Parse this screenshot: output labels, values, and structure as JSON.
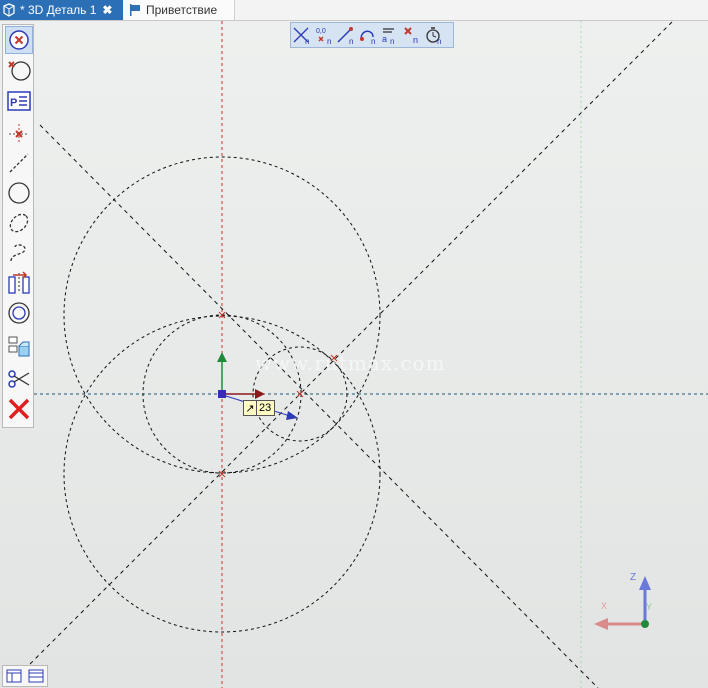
{
  "tabs": [
    {
      "label": "* 3D Деталь 1",
      "active": true
    },
    {
      "label": "Приветствие",
      "active": false
    }
  ],
  "tab_close_symbol": "✖",
  "left_toolbar": [
    {
      "icon": "stop-command-icon",
      "selected": true
    },
    {
      "icon": "circle-through-point-icon",
      "selected": false
    },
    {
      "icon": "parameters-panel-icon",
      "selected": false
    },
    {
      "icon": "point-icon",
      "selected": false
    },
    {
      "icon": "line-icon",
      "selected": false
    },
    {
      "icon": "circle-icon",
      "selected": false
    },
    {
      "icon": "ellipse-icon",
      "selected": false
    },
    {
      "icon": "spline-icon",
      "selected": false
    },
    {
      "icon": "mirror-icon",
      "selected": false
    },
    {
      "icon": "concentric-circle-icon",
      "selected": false
    },
    {
      "icon": "project-geometry-icon",
      "selected": false
    },
    {
      "icon": "scissors-icon",
      "selected": false
    },
    {
      "icon": "delete-icon",
      "selected": false
    }
  ],
  "top_toolbar": [
    {
      "icon": "snap-intersection-icon"
    },
    {
      "icon": "snap-coordinates-icon"
    },
    {
      "icon": "snap-endpoint-icon"
    },
    {
      "icon": "snap-tangent-icon"
    },
    {
      "icon": "snap-text-icon"
    },
    {
      "icon": "snap-off-icon"
    },
    {
      "icon": "snap-settings-icon"
    }
  ],
  "dimension_value": "23",
  "watermark": "www.rutmax.com",
  "triad": {
    "z": "Z",
    "y": "Y",
    "x": "X"
  },
  "colors": {
    "tab_active": "#2b6fb7",
    "axis_red": "#c0392b",
    "axis_green": "#1f8a3a",
    "axis_blue": "#2b3bb7",
    "construction": "#111111"
  }
}
